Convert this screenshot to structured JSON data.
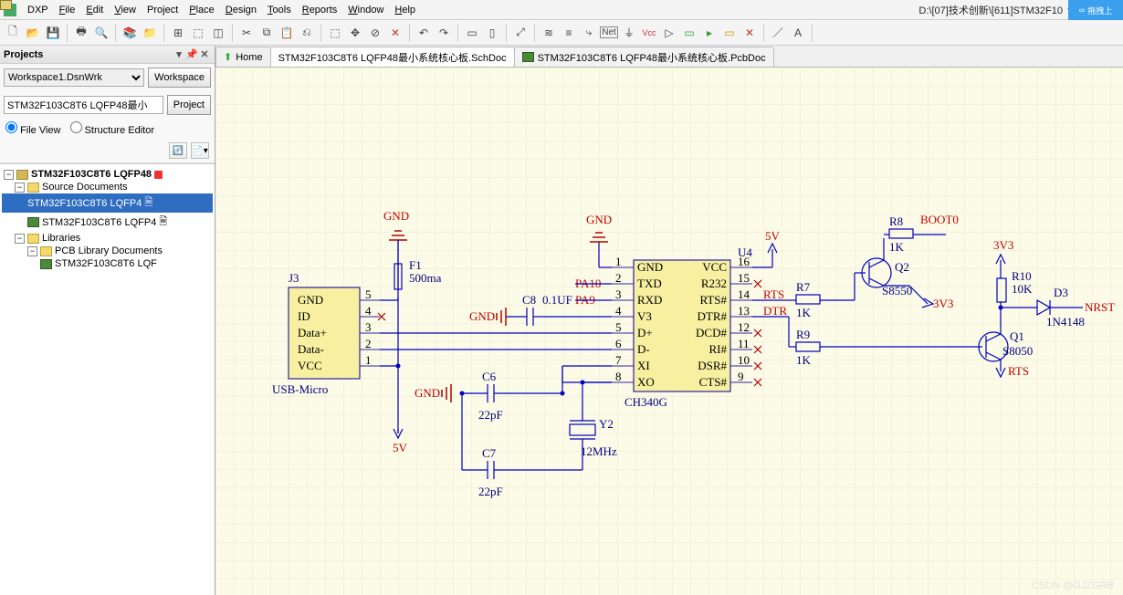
{
  "menu": {
    "items": [
      "DXP",
      "File",
      "Edit",
      "View",
      "Project",
      "Place",
      "Design",
      "Tools",
      "Reports",
      "Window",
      "Help"
    ]
  },
  "path": "D:\\[07]技术创新\\[611]STM32F10",
  "sync_badge": "拖拽上",
  "projects_panel": {
    "title": "Projects",
    "workspace": "Workspace1.DsnWrk",
    "workspace_btn": "Workspace",
    "project": "STM32F103C8T6 LQFP48最小",
    "project_btn": "Project",
    "radio1": "File View",
    "radio2": "Structure Editor"
  },
  "tree": {
    "root": "STM32F103C8T6 LQFP48",
    "src_folder": "Source Documents",
    "sch_doc": "STM32F103C8T6 LQFP4",
    "pcb_doc": "STM32F103C8T6 LQFP4",
    "lib_folder": "Libraries",
    "lib_sub": "PCB Library Documents",
    "lib_file": "STM32F103C8T6 LQF"
  },
  "tabs": {
    "home": "Home",
    "sch": "STM32F103C8T6 LQFP48最小系统核心板.SchDoc",
    "pcb": "STM32F103C8T6 LQFP48最小系统核心板.PcbDoc"
  },
  "sch": {
    "J3": {
      "ref": "J3",
      "name": "USB-Micro",
      "pins": [
        "GND",
        "ID",
        "Data+",
        "Data-",
        "VCC"
      ],
      "nums": [
        "5",
        "4",
        "3",
        "2",
        "1"
      ]
    },
    "U4": {
      "ref": "U4",
      "name": "CH340G",
      "left": [
        "GND",
        "TXD",
        "RXD",
        "V3",
        "D+",
        "D-",
        "XI",
        "XO"
      ],
      "right": [
        "VCC",
        "R232",
        "RTS#",
        "DTR#",
        "DCD#",
        "RI#",
        "DSR#",
        "CTS#"
      ],
      "lnums": [
        "1",
        "2",
        "3",
        "4",
        "5",
        "6",
        "7",
        "8"
      ],
      "rnums": [
        "16",
        "15",
        "14",
        "13",
        "12",
        "11",
        "10",
        "9"
      ]
    },
    "F1": {
      "ref": "F1",
      "val": "500ma"
    },
    "C8": {
      "ref": "C8",
      "val": "0.1UF"
    },
    "C6": {
      "ref": "C6",
      "val": "22pF"
    },
    "C7": {
      "ref": "C7",
      "val": "22pF"
    },
    "Y2": {
      "ref": "Y2",
      "val": "12MHz"
    },
    "R7": {
      "ref": "R7",
      "val": "1K"
    },
    "R8": {
      "ref": "R8",
      "val": "1K"
    },
    "R9": {
      "ref": "R9",
      "val": "1K"
    },
    "R10": {
      "ref": "R10",
      "val": "10K"
    },
    "Q1": {
      "ref": "Q1",
      "val": "S8050"
    },
    "Q2": {
      "ref": "Q2",
      "val": "S8550"
    },
    "D3": {
      "ref": "D3",
      "val": "1N4148"
    },
    "nets": {
      "GND": "GND",
      "V5": "5V",
      "V33": "3V3",
      "PA9": "PA9",
      "PA10": "PA10",
      "BOOT0": "BOOT0",
      "NRST": "NRST",
      "RTS": "RTS",
      "DTR": "DTR"
    }
  },
  "watermark": "CSDN @GJZGRB"
}
